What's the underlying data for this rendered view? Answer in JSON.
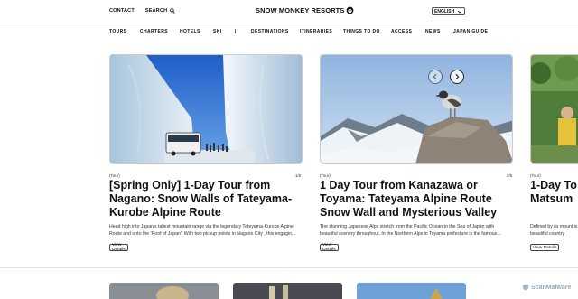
{
  "header": {
    "contact_label": "CONTACT",
    "search_label": "SEARCH",
    "logo_text": "SNOW MONKEY RESORTS",
    "language": "ENGLISH"
  },
  "nav": {
    "items": [
      "TOURS",
      "CHARTERS",
      "HOTELS",
      "SKI",
      "|",
      "DESTINATIONS",
      "ITINERARIES",
      "THINGS TO DO",
      "ACCESS",
      "NEWS",
      "JAPAN GUIDE"
    ]
  },
  "cards": [
    {
      "type": "(Tour)",
      "page": "1/5",
      "title": "[Spring Only] 1-Day Tour from Nagano: Snow Walls of Tateyama-Kurobe Alpine Route",
      "desc": "Head high into Japan's tallest mountain range via the legendary Tateyama-Kurobe Alpine Route and onto the 'Roof of Japan'. With two pickup points in Nagano City , this engagin...",
      "button": "View Details"
    },
    {
      "type": "(Tour)",
      "page": "2/5",
      "title": "1 Day Tour from Kanazawa or Toyama: Tateyama Alpine Route Snow Wall and Mysterious Valley",
      "desc": "The stunning Japanese Alps stretch from the Pacific Ocean to the Sea of Japan with beautiful scenery throughout. In the Northern Alps in Toyama prefecture is the famous...",
      "button": "View Details"
    },
    {
      "type": "(Tour)",
      "title": "1-Day To Matsum",
      "desc": "Defined by its mount is this beautiful country",
      "button": "View Details"
    }
  ],
  "watermark": "ScanMalware",
  "colors": {
    "text": "#111111",
    "divider": "#e2e2e2",
    "sky": "#2f6fd0",
    "snow": "#eef3f8"
  },
  "icons": [
    "search-icon",
    "monkey-logo-icon",
    "chevron-down-icon",
    "arrow-left-icon",
    "arrow-right-icon",
    "shield-icon"
  ]
}
